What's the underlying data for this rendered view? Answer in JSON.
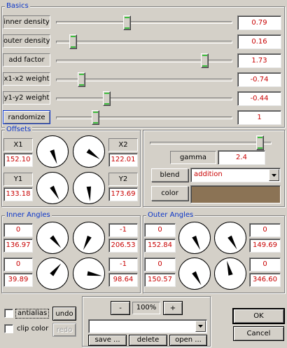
{
  "basics": {
    "title": "Basics",
    "rows": [
      {
        "label": "inner density",
        "value": "0.79",
        "level": 0.4
      },
      {
        "label": "outer density",
        "value": "0.16",
        "level": 0.08
      },
      {
        "label": "add factor",
        "value": "1.73",
        "level": 0.86
      },
      {
        "label": "x1-x2 weight",
        "value": "-0.74",
        "level": 0.13
      },
      {
        "label": "y1-y2 weight",
        "value": "-0.44",
        "level": 0.28
      },
      {
        "label": "randomize",
        "value": "1",
        "level": 0.21
      }
    ]
  },
  "offsets": {
    "title": "Offsets",
    "x1": {
      "label": "X1",
      "value": "152.10"
    },
    "x2": {
      "label": "X2",
      "value": "122.01"
    },
    "y1": {
      "label": "Y1",
      "value": "133.18"
    },
    "y2": {
      "label": "Y2",
      "value": "173.69"
    }
  },
  "gamma": {
    "label": "gamma",
    "value": "2.4",
    "level": 0.93
  },
  "blend": {
    "label": "blend",
    "selected": "addition"
  },
  "color": {
    "label": "color",
    "swatch": "#8b7355"
  },
  "inner_angles": {
    "title": "Inner Angles",
    "cells": [
      {
        "top": "0",
        "bottom": "136.97"
      },
      {
        "top": "-1",
        "bottom": "206.53"
      },
      {
        "top": "0",
        "bottom": "39.89"
      },
      {
        "top": "-1",
        "bottom": "98.64"
      }
    ]
  },
  "outer_angles": {
    "title": "Outer Angles",
    "cells": [
      {
        "top": "0",
        "bottom": "152.84"
      },
      {
        "top": "0",
        "bottom": "149.69"
      },
      {
        "top": "0",
        "bottom": "150.57"
      },
      {
        "top": "0",
        "bottom": "346.60"
      }
    ]
  },
  "options": {
    "antialias": "antialias",
    "clip_color": "clip color",
    "undo": "undo",
    "redo": "redo"
  },
  "zoom": {
    "minus": "-",
    "value": "100%",
    "plus": "+"
  },
  "preset": {
    "selected": "",
    "save": "save ...",
    "delete": "delete",
    "open": "open ..."
  },
  "dialog": {
    "ok": "OK",
    "cancel": "Cancel"
  }
}
